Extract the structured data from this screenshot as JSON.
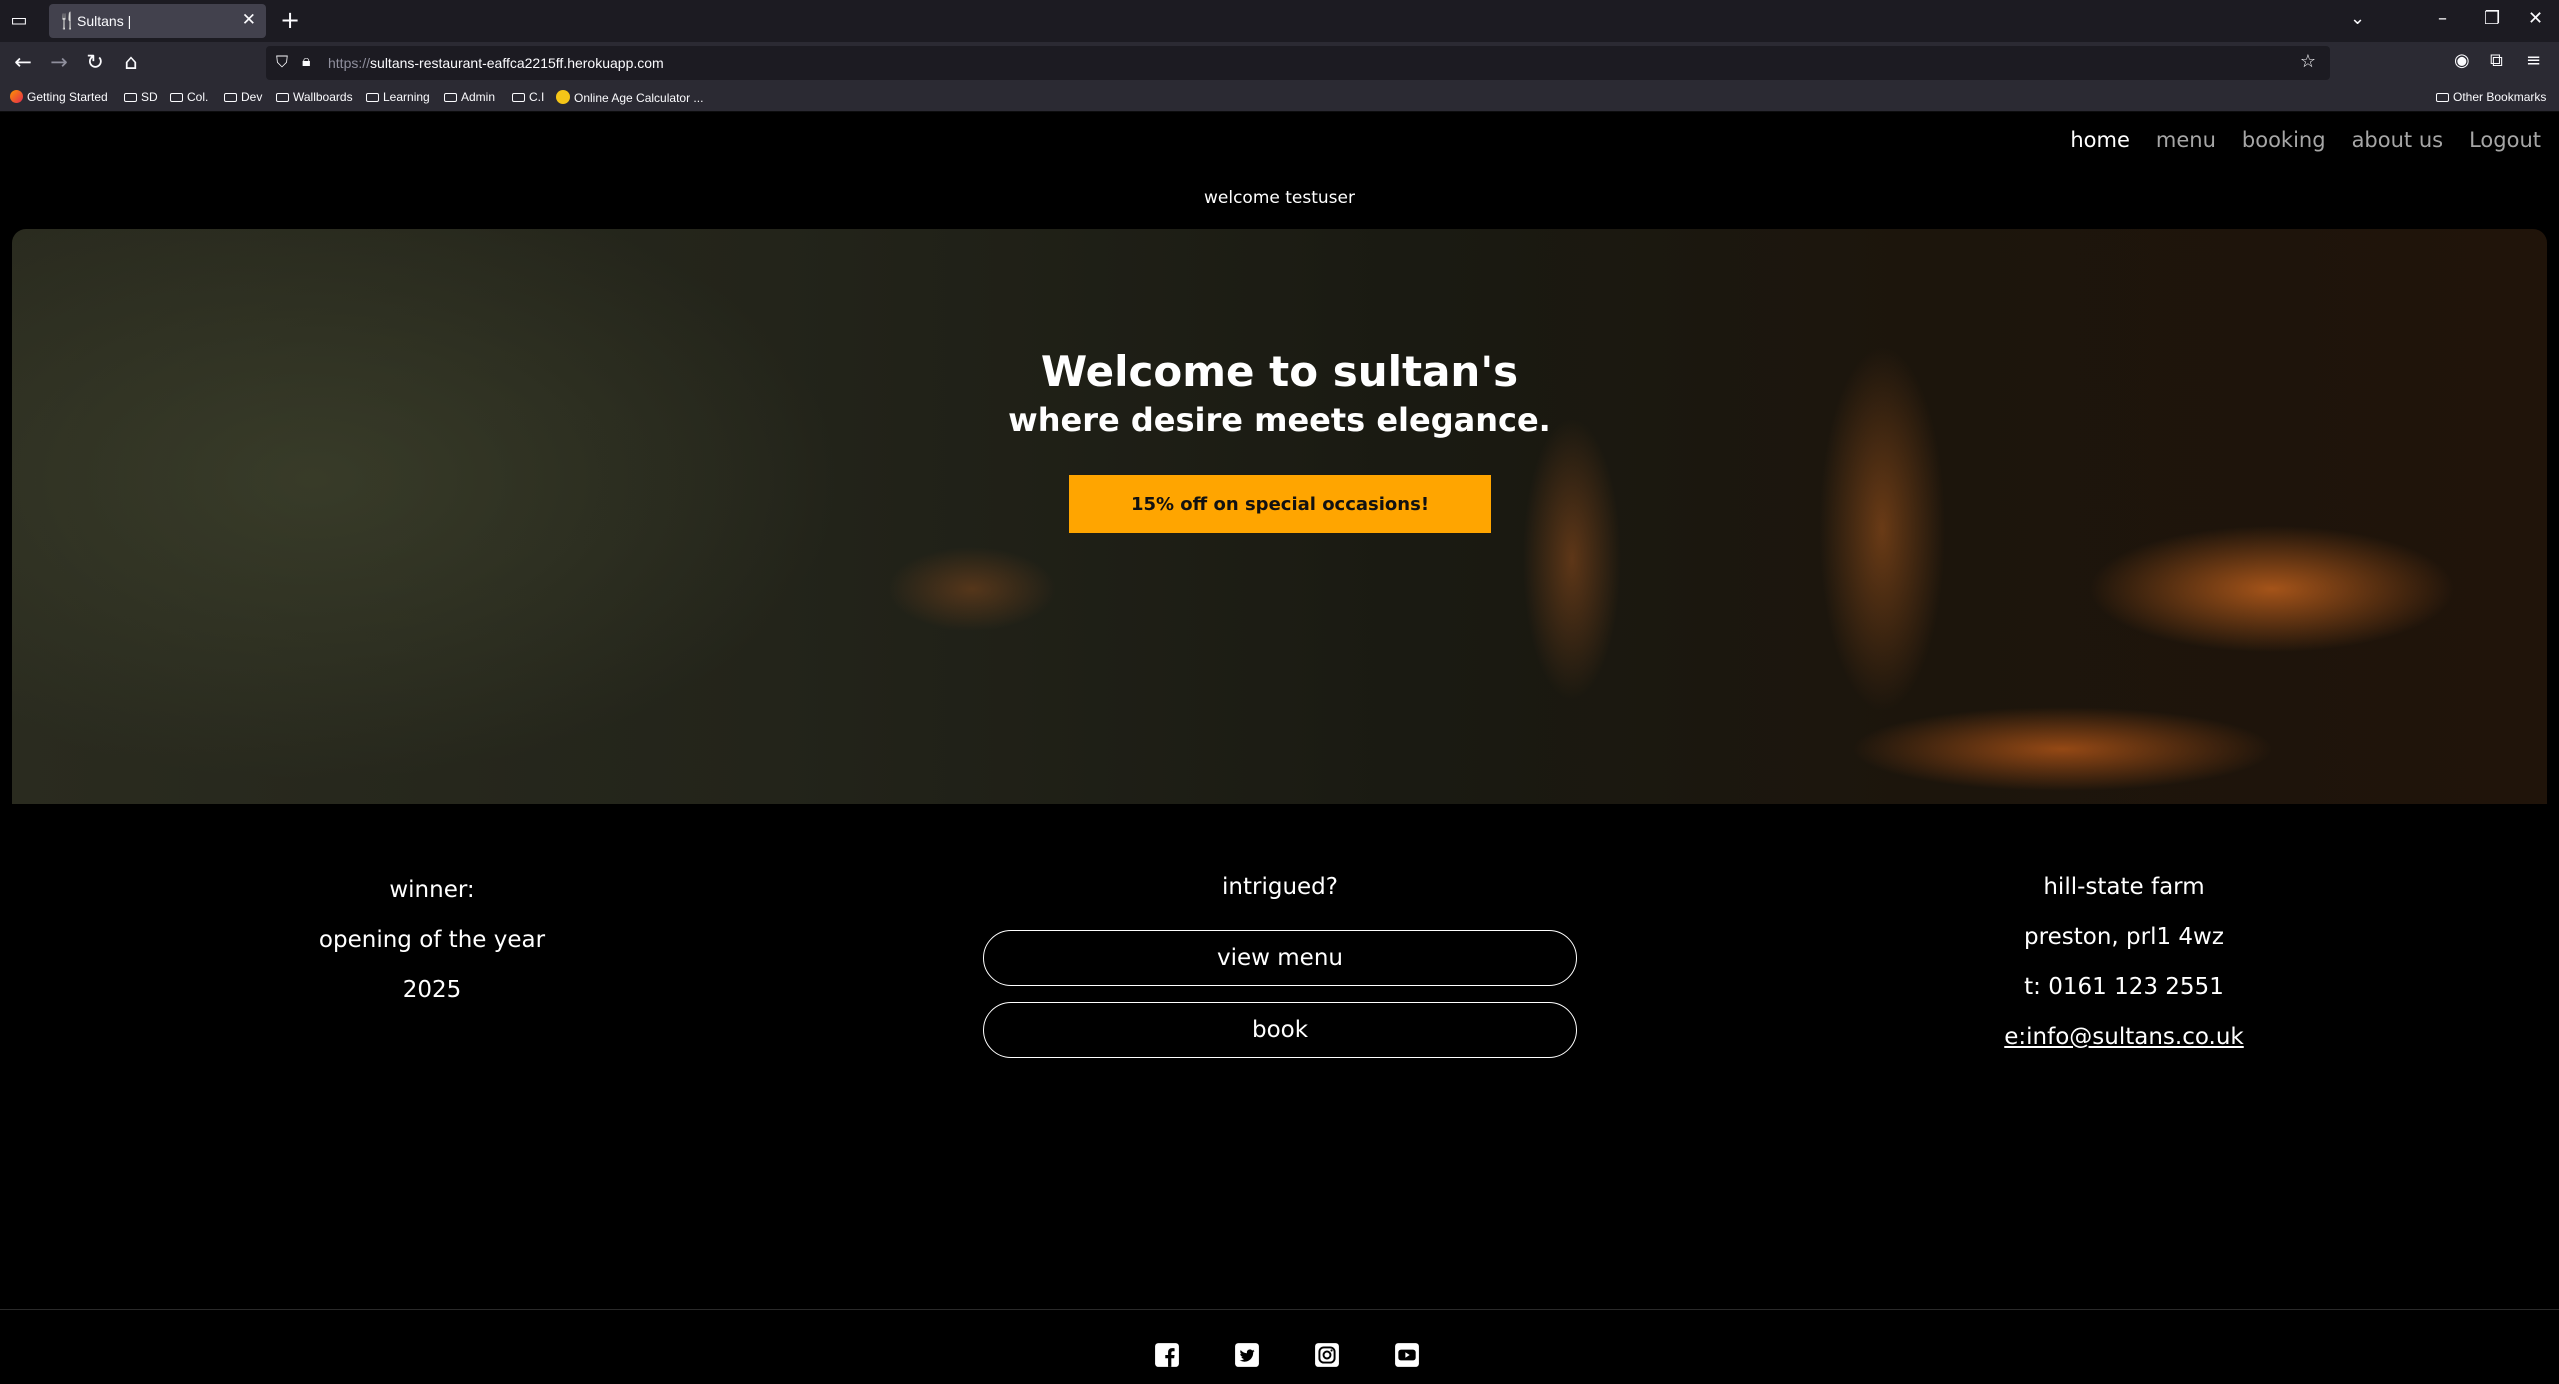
{
  "browser": {
    "tab_title": "Sultans |",
    "url_scheme": "https://",
    "url_host": "sultans-restaurant-eaffca2215ff.herokuapp.com",
    "bookmarks": [
      {
        "label": "Getting Started",
        "icon": "firefox-icon"
      },
      {
        "label": "SD",
        "icon": "folder-icon"
      },
      {
        "label": "Col.",
        "icon": "folder-icon"
      },
      {
        "label": "Dev",
        "icon": "folder-icon"
      },
      {
        "label": "Wallboards",
        "icon": "folder-icon"
      },
      {
        "label": "Learning",
        "icon": "folder-icon"
      },
      {
        "label": "Admin",
        "icon": "folder-icon"
      },
      {
        "label": "C.I",
        "icon": "folder-icon"
      },
      {
        "label": "Online Age Calculator ...",
        "icon": "calculator-icon"
      }
    ],
    "other_bookmarks": "Other Bookmarks"
  },
  "nav": {
    "home": "home",
    "menu": "menu",
    "booking": "booking",
    "about": "about us",
    "logout": "Logout"
  },
  "welcome_user": "welcome testuser",
  "hero": {
    "title": "Welcome to sultan's",
    "subtitle": "where desire meets elegance.",
    "promo": "15% off on special occasions!"
  },
  "award": {
    "line1": "winner:",
    "line2": "opening of the year",
    "line3": "2025"
  },
  "cta": {
    "heading": "intrigued?",
    "view_menu": "view menu",
    "book": "book"
  },
  "contact": {
    "address1": "hill-state farm",
    "address2": "preston, prl1 4wz",
    "phone": "t: 0161 123 2551",
    "email": "e:info@sultans.co.uk"
  },
  "social": [
    "facebook-icon",
    "twitter-icon",
    "instagram-icon",
    "youtube-icon"
  ],
  "colors": {
    "accent": "#ffa500",
    "background": "#000000"
  }
}
